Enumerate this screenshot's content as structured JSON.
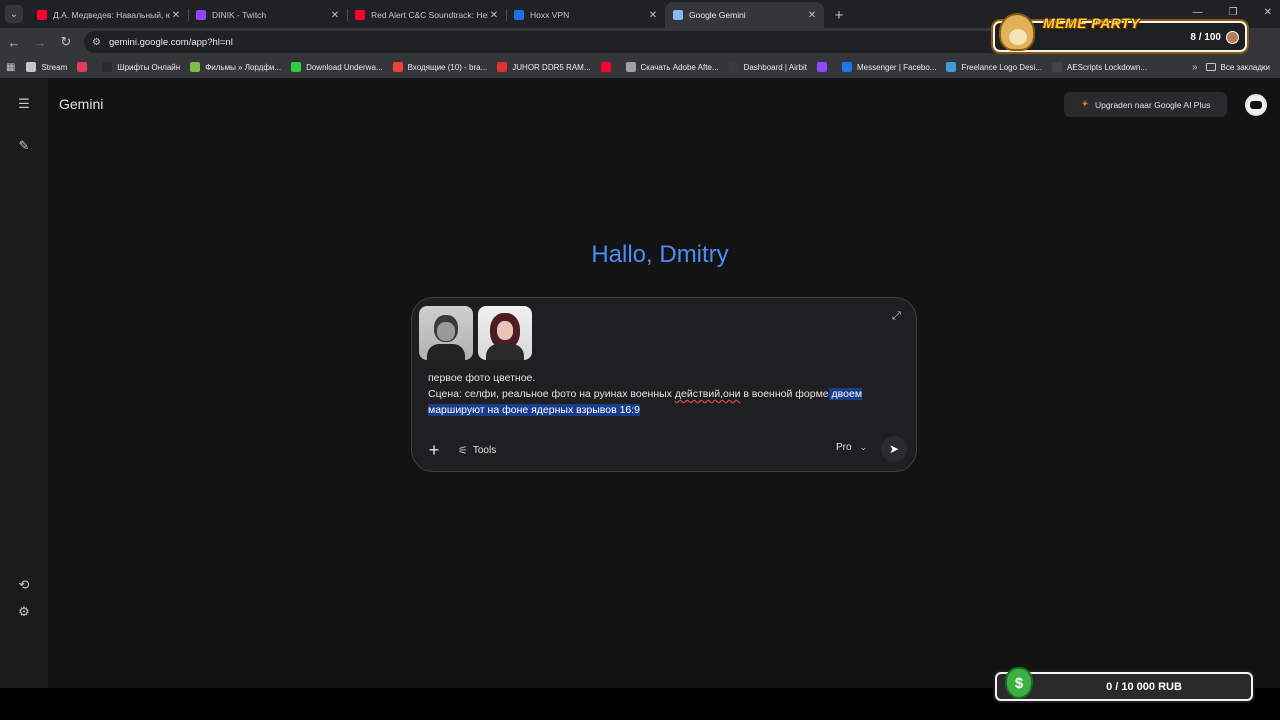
{
  "browser": {
    "tabs": [
      {
        "title": "Д.А. Медведев: Навальный, ю",
        "favicon": "youtube-icon",
        "color": "#ff0033",
        "active": false
      },
      {
        "title": "DINIK - Twitch",
        "favicon": "twitch-icon",
        "color": "#9146ff",
        "active": false
      },
      {
        "title": "Red Alert C&C Soundtrack: Hell",
        "favicon": "youtube-icon",
        "color": "#ff0033",
        "active": false
      },
      {
        "title": "Hoxx VPN",
        "favicon": "vpn-icon",
        "color": "#1a73e8",
        "active": false
      },
      {
        "title": "Google Gemini",
        "favicon": "gemini-icon",
        "color": "#8ab4f8",
        "active": true
      }
    ],
    "new_tab_symbol": "+",
    "window_controls": [
      "—",
      "❐",
      "✕"
    ],
    "url": "gemini.google.com/app?hl=nl",
    "bookmarks": [
      {
        "label": "Stream",
        "favicon": "folder-icon",
        "color": "#c4c7c5"
      },
      {
        "label": "",
        "favicon": "live-icon",
        "color": "#e23b5a"
      },
      {
        "label": "Шрифты Онлайн",
        "favicon": "fonts-icon",
        "color": "#2b2b2b"
      },
      {
        "label": "Фильмы » Лордфи...",
        "favicon": "films-icon",
        "color": "#7bc043"
      },
      {
        "label": "Download Underwa...",
        "favicon": "ae-icon",
        "color": "#2ecc40"
      },
      {
        "label": "Входящие (10) - bra...",
        "favicon": "gmail-icon",
        "color": "#ea4335"
      },
      {
        "label": "JUHOR DDR5 RAM...",
        "favicon": "aliexpress-icon",
        "color": "#e62e2e"
      },
      {
        "label": "",
        "favicon": "youtube-icon",
        "color": "#ff0033"
      },
      {
        "label": "Скачать Adobe Afte...",
        "favicon": "globe-icon",
        "color": "#9aa0a6"
      },
      {
        "label": "Dashboard | Airbit",
        "favicon": "airbit-icon",
        "color": "#3a3a3a"
      },
      {
        "label": "",
        "favicon": "twitch-icon",
        "color": "#9146ff"
      },
      {
        "label": "Messenger | Facebo...",
        "favicon": "facebook-icon",
        "color": "#1877f2"
      },
      {
        "label": "Freelance Logo Desi...",
        "favicon": "freelance-icon",
        "color": "#3b9bd6"
      },
      {
        "label": "AEScripts Lockdown...",
        "favicon": "aescripts-icon",
        "color": "#444"
      }
    ],
    "bookmarks_more": "»",
    "all_bookmarks": "Все закладки"
  },
  "gemini": {
    "brand": "Gemini",
    "upgrade_label": "Upgraden naar Google AI Plus",
    "greeting": "Hallo, Dmitry",
    "prompt": {
      "line1": "первое фото цветное.",
      "line2_start": "Сцена: селфи, реальное фото на руинах военных ",
      "line2_misspelled": "действий,они",
      "line2_rest": " в военной форме",
      "line2_selected": " двоем",
      "line3_selected": "маршируют на фоне ядерных взрывов 16:9"
    },
    "tools_label": "Tools",
    "model_label": "Pro"
  },
  "overlays": {
    "meme_party_title": "MEME PARTY",
    "meme_party_count": "8 / 100",
    "donation_text": "0 / 10 000 RUB",
    "donation_symbol": "$"
  },
  "colors": {
    "greeting": "#4c8df6",
    "selection": "#1a3c8c",
    "page_bg": "#131314"
  }
}
